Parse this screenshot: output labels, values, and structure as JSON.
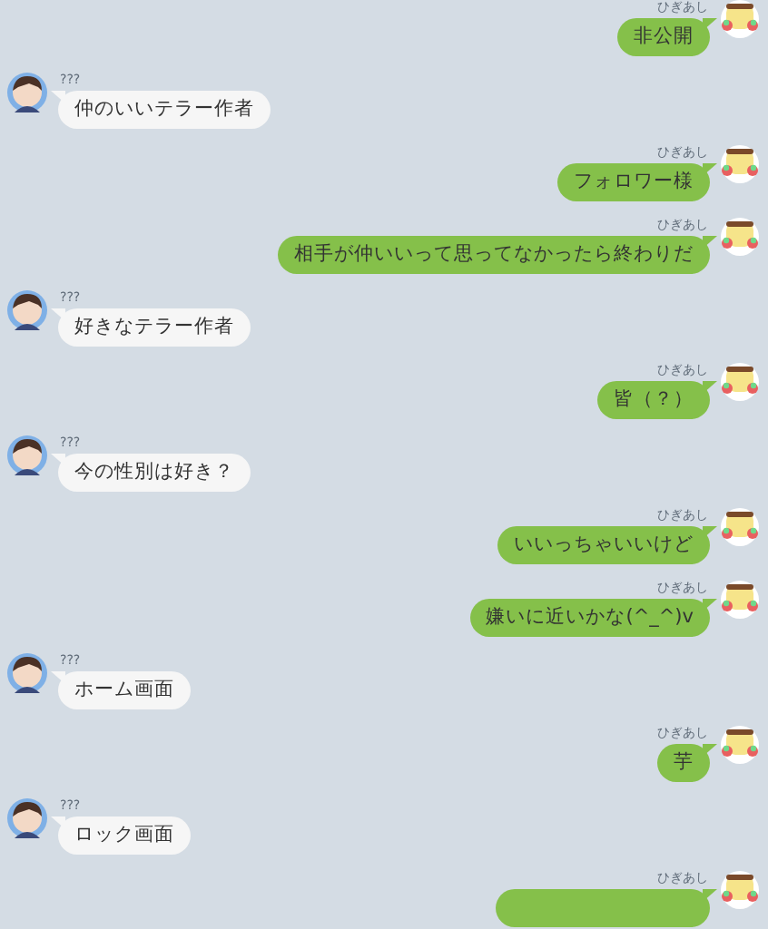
{
  "messages": [
    {
      "kind": "sent",
      "sender": "ひぎあし",
      "text": "非公開"
    },
    {
      "kind": "received",
      "sender": "???",
      "text": "仲のいいテラー作者"
    },
    {
      "kind": "sent",
      "sender": "ひぎあし",
      "text": "フォロワー様"
    },
    {
      "kind": "sent",
      "sender": "ひぎあし",
      "text": "相手が仲いいって思ってなかったら終わりだ"
    },
    {
      "kind": "received",
      "sender": "???",
      "text": "好きなテラー作者"
    },
    {
      "kind": "sent",
      "sender": "ひぎあし",
      "text": "皆（？）"
    },
    {
      "kind": "received",
      "sender": "???",
      "text": "今の性別は好き？"
    },
    {
      "kind": "sent",
      "sender": "ひぎあし",
      "text": "いいっちゃいいけど"
    },
    {
      "kind": "sent",
      "sender": "ひぎあし",
      "text": "嫌いに近いかな(^_^)v"
    },
    {
      "kind": "received",
      "sender": "???",
      "text": "ホーム画面"
    },
    {
      "kind": "sent",
      "sender": "ひぎあし",
      "text": "芋"
    },
    {
      "kind": "received",
      "sender": "???",
      "text": "ロック画面"
    },
    {
      "kind": "sent",
      "sender": "ひぎあし"
    }
  ]
}
